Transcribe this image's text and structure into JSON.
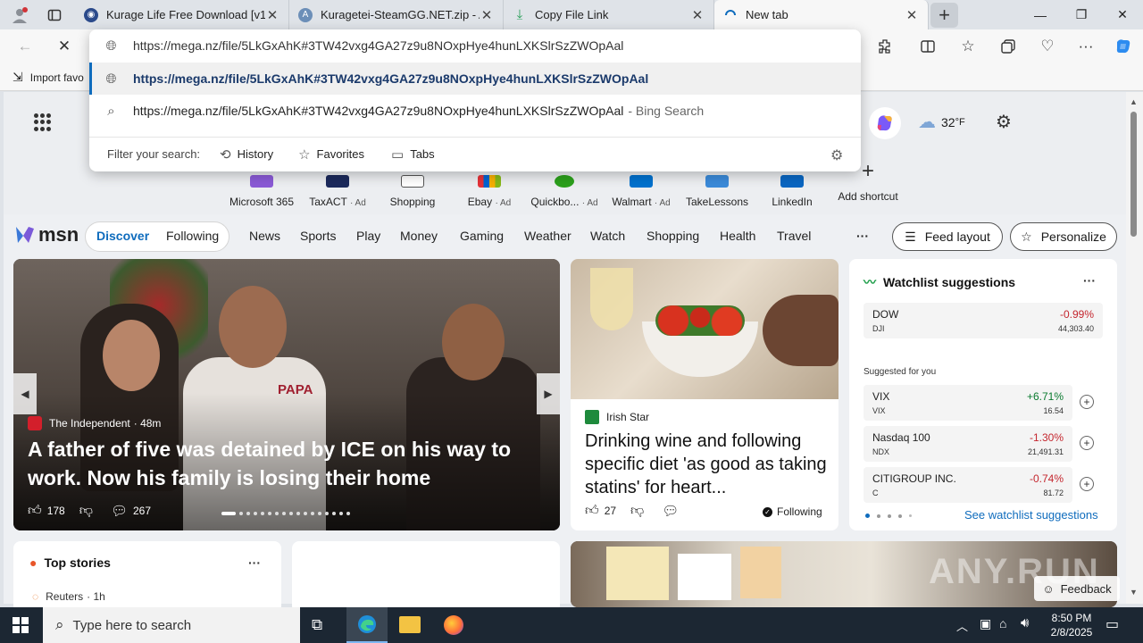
{
  "browser": {
    "tabs": [
      {
        "title": "Kurage Life Free Download [v1.4",
        "favicon": "site-icon"
      },
      {
        "title": "Kuragetei-SteamGG.NET.zip - Ak",
        "favicon": "site-icon"
      },
      {
        "title": "Copy File Link",
        "favicon": "download-icon"
      },
      {
        "title": "New tab",
        "favicon": "loading-icon"
      }
    ],
    "favorites_bar_label": "Import favo"
  },
  "omnibox": {
    "typed_url": "https://mega.nz/file/5LkGxAhK#3TW42vxg4GA27z9u8NOxpHye4hunLXKSlrSzZWOpAal",
    "suggestion_url": "https://mega.nz/file/5LkGxAhK#3TW42vxg4GA27z9u8NOxpHye4hunLXKSlrSzZWOpAal",
    "search_text": "https://mega.nz/file/5LkGxAhK#3TW42vxg4GA27z9u8NOxpHye4hunLXKSlrSzZWOpAal",
    "search_suffix": "- Bing Search",
    "filter_label": "Filter your search:",
    "filters": [
      "History",
      "Favorites",
      "Tabs"
    ]
  },
  "newtab": {
    "weather_temp": "32",
    "weather_unit": "°F",
    "shortcuts": [
      {
        "label": "Microsoft 365",
        "ad": ""
      },
      {
        "label": "TaxACT",
        "ad": "· Ad"
      },
      {
        "label": "Shopping",
        "ad": ""
      },
      {
        "label": "Ebay",
        "ad": "· Ad"
      },
      {
        "label": "Quickbo...",
        "ad": "· Ad"
      },
      {
        "label": "Walmart",
        "ad": "· Ad"
      },
      {
        "label": "TakeLessons",
        "ad": ""
      },
      {
        "label": "LinkedIn",
        "ad": ""
      },
      {
        "label": "Add shortcut",
        "ad": ""
      }
    ]
  },
  "msn": {
    "logo": "msn",
    "discover": "Discover",
    "following": "Following",
    "nav": [
      "News",
      "Sports",
      "Play",
      "Money",
      "Gaming",
      "Weather",
      "Watch",
      "Shopping",
      "Health",
      "Travel"
    ],
    "more": "···",
    "feed_layout": "Feed layout",
    "personalize": "Personalize"
  },
  "hero": {
    "source": "The Independent",
    "age": "· 48m",
    "headline": "A father of five was detained by ICE on his way to work. Now his family is losing their home",
    "likes": "178",
    "comments": "267",
    "shirt_text": "PAPA"
  },
  "article2": {
    "source": "Irish Star",
    "headline": "Drinking wine and following specific diet 'as good as taking statins' for heart...",
    "likes": "27",
    "following": "Following"
  },
  "watchlist": {
    "title": "Watchlist suggestions",
    "more": "···",
    "main": {
      "name": "DOW",
      "symbol": "DJI",
      "change": "-0.99%",
      "price": "44,303.40"
    },
    "suggested_label": "Suggested for you",
    "suggested": [
      {
        "name": "VIX",
        "symbol": "VIX",
        "change": "+6.71%",
        "price": "16.54"
      },
      {
        "name": "Nasdaq 100",
        "symbol": "NDX",
        "change": "-1.30%",
        "price": "21,491.31"
      },
      {
        "name": "CITIGROUP INC.",
        "symbol": "C",
        "change": "-0.74%",
        "price": "81.72"
      }
    ],
    "see_more": "See watchlist suggestions",
    "colors": {
      "up": "#0a7a2f",
      "down": "#c4262e"
    }
  },
  "top_stories": {
    "title": "Top stories",
    "more": "···",
    "first_source": "Reuters",
    "first_age": "· 1h"
  },
  "watermark": "ANY.RUN",
  "feedback": "Feedback",
  "taskbar": {
    "search_placeholder": "Type here to search",
    "time": "8:50 PM",
    "date": "2/8/2025"
  }
}
